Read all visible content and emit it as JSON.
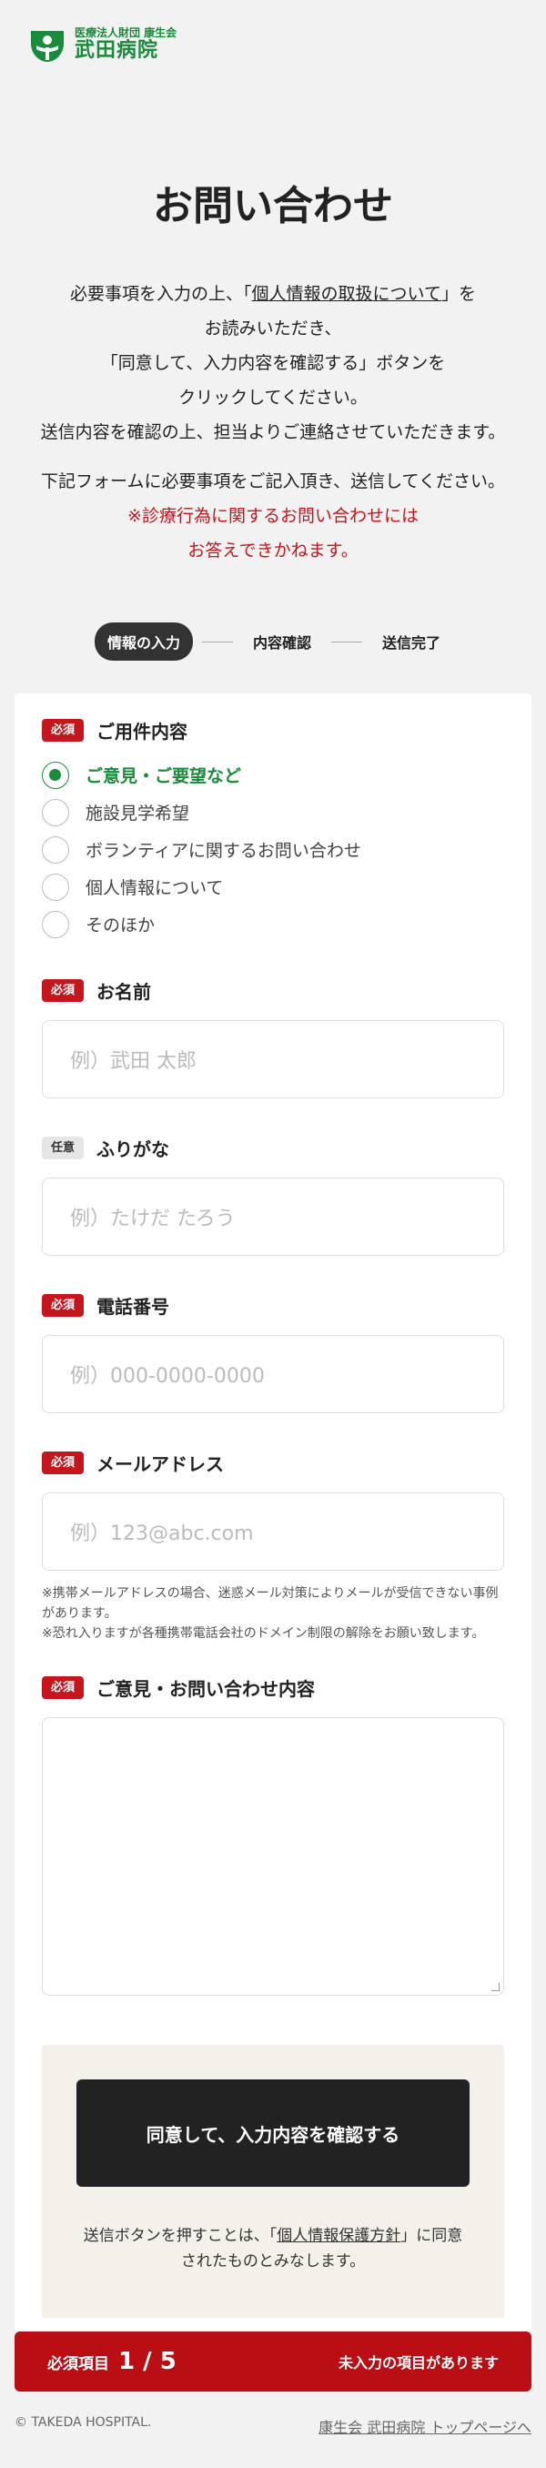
{
  "header": {
    "logo_sub": "医療法人財団 康生会",
    "logo_main": "武田病院"
  },
  "page_title": "お問い合わせ",
  "intro": {
    "line1_pre": "必要事項を入力の上、「",
    "line1_link": "個人情報の取扱について",
    "line1_post": "」を",
    "line2": "お読みいただき、",
    "line3": "「同意して、入力内容を確認する」ボタンを",
    "line4": "クリックしてください。",
    "line5": "送信内容を確認の上、担当よりご連絡させていただきます。"
  },
  "notice": {
    "line1": "下記フォームに必要事項をご記入頂き、送信してください。",
    "warn1": "※診療行為に関するお問い合わせには",
    "warn2": "お答えできかねます。"
  },
  "steps": [
    "情報の入力",
    "内容確認",
    "送信完了"
  ],
  "badges": {
    "required": "必須",
    "optional": "任意"
  },
  "form": {
    "inquiry_type": {
      "label": "ご用件内容",
      "options": [
        "ご意見・ご要望など",
        "施設見学希望",
        "ボランティアに関するお問い合わせ",
        "個人情報について",
        "そのほか"
      ],
      "selected_index": 0
    },
    "name": {
      "label": "お名前",
      "placeholder": "例）武田 太郎"
    },
    "furigana": {
      "label": "ふりがな",
      "placeholder": "例）たけだ たろう"
    },
    "phone": {
      "label": "電話番号",
      "placeholder": "例）000-0000-0000"
    },
    "email": {
      "label": "メールアドレス",
      "placeholder": "例）123@abc.com",
      "note1": "※携帯メールアドレスの場合、迷惑メール対策によりメールが受信できない事例があります。",
      "note2": "※恐れ入りますが各種携帯電話会社のドメイン制限の解除をお願い致します。"
    },
    "message": {
      "label": "ご意見・お問い合わせ内容"
    }
  },
  "confirm": {
    "button": "同意して、入力内容を確認する",
    "consent_pre": "送信ボタンを押すことは、「",
    "consent_link": "個人情報保護方針",
    "consent_post": "」に同意されたものとみなします。"
  },
  "status": {
    "label": "必須項目",
    "count": "1 / 5",
    "message": "未入力の項目があります"
  },
  "footer": {
    "copyright": "© TAKEDA HOSPITAL.",
    "link": "康生会 武田病院 トップページへ"
  },
  "colors": {
    "brand_green": "#1a8b3a",
    "alert_red": "#c4161c",
    "status_red": "#b80e14"
  }
}
